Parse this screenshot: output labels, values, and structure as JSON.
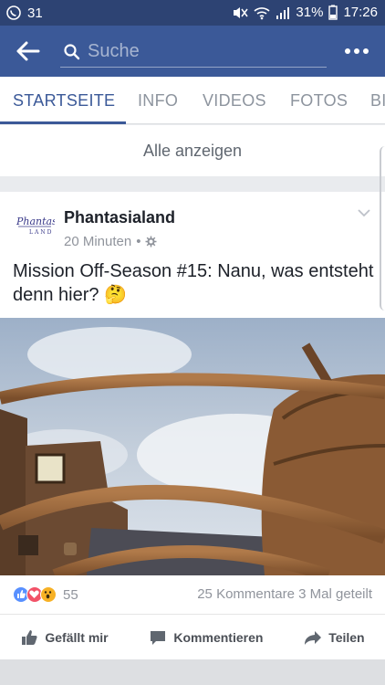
{
  "status_bar": {
    "notification_count": "31",
    "battery_percent": "31%",
    "time": "17:26"
  },
  "app_bar": {
    "search_placeholder": "Suche"
  },
  "tabs": [
    {
      "label": "STARTSEITE",
      "active": true
    },
    {
      "label": "INFO",
      "active": false
    },
    {
      "label": "VIDEOS",
      "active": false
    },
    {
      "label": "FOTOS",
      "active": false
    },
    {
      "label": "BI",
      "active": false
    }
  ],
  "see_all": "Alle anzeigen",
  "post": {
    "page_name": "Phantasialand",
    "time_ago": "20 Minuten",
    "separator": "•",
    "text": "Mission Off-Season #15: Nanu, was entsteht denn hier? 🤔",
    "reaction_count": "55",
    "comments": "25 Kommentare",
    "shares": "3 Mal geteilt",
    "actions": {
      "like": "Gefällt mir",
      "comment": "Kommentieren",
      "share": "Teilen"
    }
  },
  "colors": {
    "brand_blue": "#3b5998",
    "status_blue": "#2d4373",
    "like_blue": "#5890ff",
    "love_red": "#f25268",
    "wow_yellow": "#f7b125"
  }
}
